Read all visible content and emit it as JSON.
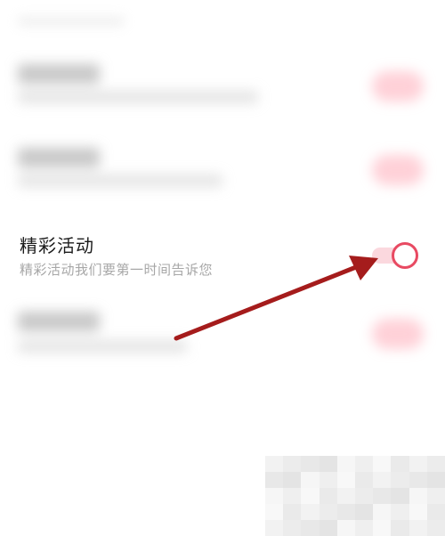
{
  "settings": {
    "items": [
      {
        "title": "精彩活动",
        "subtitle": "精彩活动我们要第一时间告诉您",
        "enabled": true
      }
    ]
  },
  "colors": {
    "accent": "#e84a62",
    "track_on": "#fbd8de",
    "title_text": "#1c1c1c",
    "subtitle_text": "#a7a7a7",
    "arrow": "#a51c1c"
  },
  "icons": {
    "annotation": "red-arrow-icon",
    "toggle": "toggle-switch"
  }
}
